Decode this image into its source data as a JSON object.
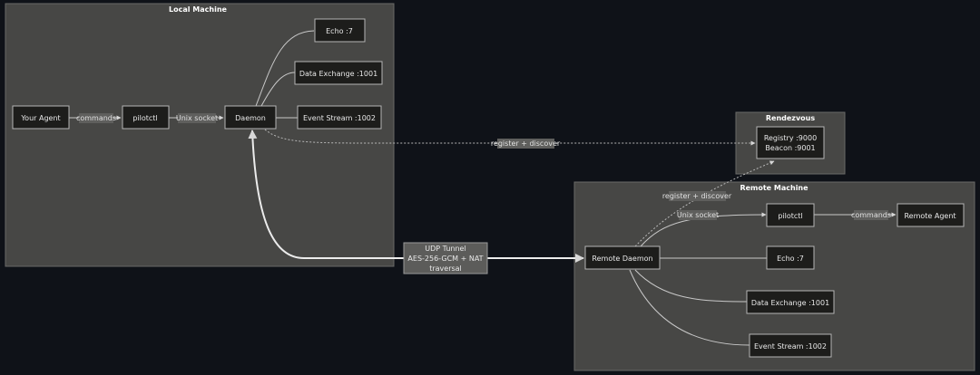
{
  "clusters": {
    "local": "Local Machine",
    "rendezvous": "Rendezvous",
    "remote": "Remote Machine"
  },
  "nodes": {
    "your_agent": "Your Agent",
    "pilotctl": "pilotctl",
    "daemon": "Daemon",
    "echo": "Echo :7",
    "data_exchange": "Data Exchange :1001",
    "event_stream": "Event Stream :1002",
    "registry": "Registry :9000",
    "beacon": "Beacon :9001",
    "tunnel_line1": "UDP Tunnel",
    "tunnel_line2": "AES-256-GCM + NAT",
    "tunnel_line3": "traversal",
    "remote_daemon": "Remote Daemon",
    "remote_pilotctl": "pilotctl",
    "remote_agent": "Remote Agent",
    "remote_echo": "Echo :7",
    "remote_data_exchange": "Data Exchange :1001",
    "remote_event_stream": "Event Stream :1002"
  },
  "edge_labels": {
    "commands": "commands",
    "unix_socket": "Unix socket",
    "register_discover": "register + discover",
    "remote_register_discover": "register + discover",
    "remote_unix_socket": "Unix socket",
    "remote_commands": "commands"
  }
}
